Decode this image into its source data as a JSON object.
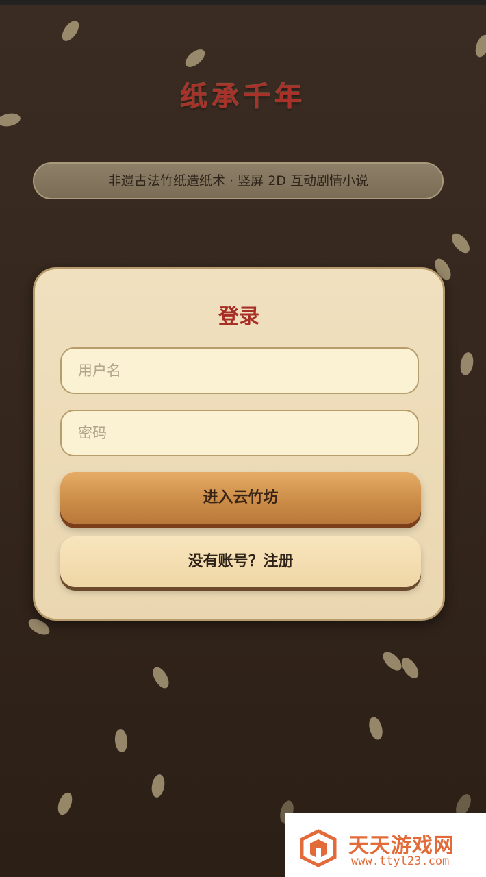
{
  "app": {
    "title": "纸承千年",
    "subtitle": "非遗古法竹纸造纸术 · 竖屏 2D 互动剧情小说"
  },
  "login": {
    "heading": "登录",
    "username_placeholder": "用户名",
    "password_placeholder": "密码",
    "submit_label": "进入云竹坊",
    "register_label": "没有账号？注册"
  },
  "watermark": {
    "name": "天天游戏网",
    "url": "www.ttyl23.com"
  },
  "colors": {
    "background": "#35271d",
    "title_red": "#a8322a",
    "card": "#f0e0bf",
    "primary_button": "#d49652",
    "watermark_orange": "#e36b3a"
  }
}
